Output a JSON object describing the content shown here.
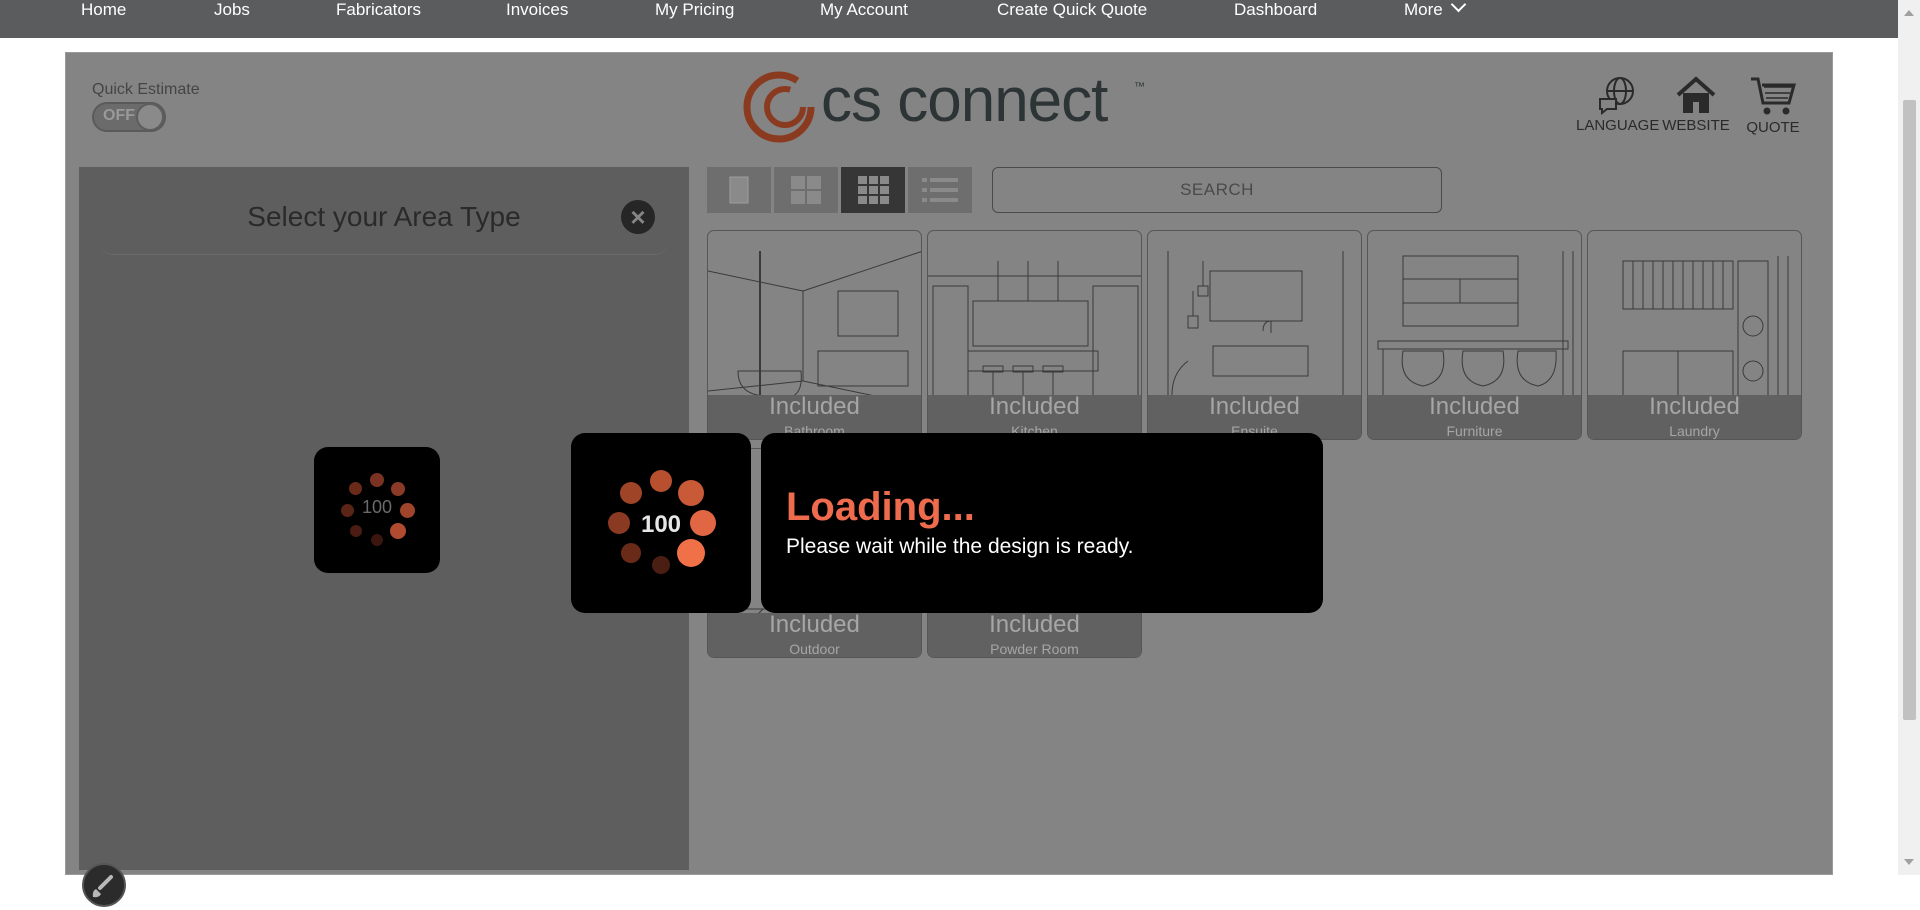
{
  "nav": {
    "items": [
      "Home",
      "Jobs",
      "Fabricators",
      "Invoices",
      "My Pricing",
      "My Account",
      "Create Quick Quote",
      "Dashboard"
    ],
    "more_label": "More"
  },
  "header": {
    "quick_estimate_label": "Quick Estimate",
    "toggle_state": "OFF",
    "logo_text": "cs connect",
    "logo_tm": "™",
    "language_label": "LANGUAGE",
    "website_label": "WEBSITE",
    "quote_label": "QUOTE"
  },
  "panel": {
    "title": "Select your Area Type",
    "close_glyph": "×",
    "spinner_value": "100"
  },
  "search": {
    "label": "SEARCH"
  },
  "tiles": [
    {
      "status": "Included",
      "name": "Bathroom"
    },
    {
      "status": "Included",
      "name": "Kitchen"
    },
    {
      "status": "Included",
      "name": "Ensuite"
    },
    {
      "status": "Included",
      "name": "Furniture"
    },
    {
      "status": "Included",
      "name": "Laundry"
    },
    {
      "status": "Included",
      "name": "Outdoor"
    },
    {
      "status": "Included",
      "name": "Powder Room"
    }
  ],
  "loading": {
    "spinner_value": "100",
    "title": "Loading...",
    "message": "Please wait while the design is ready."
  },
  "colors": {
    "accent": "#ee6c4d",
    "nav_bg": "#5a5c5e",
    "overlay_box": "#000000"
  }
}
